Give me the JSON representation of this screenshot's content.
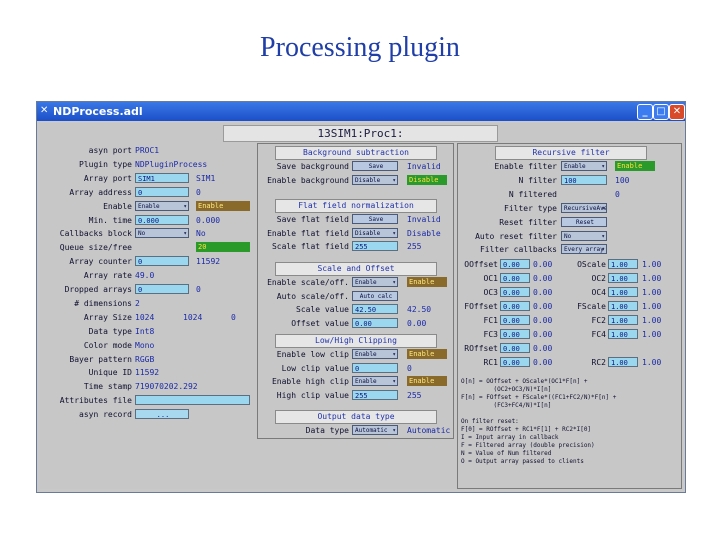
{
  "slide_title": "Processing plugin",
  "window": {
    "title": "NDProcess.adl",
    "minimize": "_",
    "maximize": "□",
    "close": "✕"
  },
  "header": "13SIM1:Proc1:",
  "colors": {
    "titlebar": "#1c4fc9",
    "input": "#9bd7ee",
    "enable_green": "#2a9a2a",
    "panel_bg": "#c7c7c7"
  },
  "left": [
    {
      "label": "asyn port",
      "value": "PROC1"
    },
    {
      "label": "Plugin type",
      "value": "NDPluginProcess"
    },
    {
      "label": "Array port",
      "input": "SIM1",
      "value": "SIM1"
    },
    {
      "label": "Array address",
      "input": "0",
      "value": "0"
    },
    {
      "label": "Enable",
      "menu": "Enable",
      "stat": "Enable",
      "stat_color": "amber"
    },
    {
      "label": "Min. time",
      "input": "0.000",
      "value": "0.000"
    },
    {
      "label": "Callbacks block",
      "menu": "No",
      "value": "No"
    },
    {
      "label": "Queue size/free",
      "value": "20",
      "stat": "20",
      "stat_color": "green"
    },
    {
      "label": "Array counter",
      "input": "0",
      "value": "11592"
    },
    {
      "label": "Array rate",
      "value": "49.0"
    },
    {
      "label": "Dropped arrays",
      "input": "0",
      "value": "0"
    },
    {
      "label": "# dimensions",
      "value": "2"
    },
    {
      "label": "Array Size",
      "values": [
        "1024",
        "1024",
        "0"
      ]
    },
    {
      "label": "Data type",
      "value": "Int8"
    },
    {
      "label": "Color mode",
      "value": "Mono"
    },
    {
      "label": "Bayer pattern",
      "value": "RGGB"
    },
    {
      "label": "Unique ID",
      "value": "11592"
    },
    {
      "label": "Time stamp",
      "value": "719070202.292"
    },
    {
      "label": "Attributes file",
      "input": ""
    },
    {
      "label": "asyn record",
      "button": "..."
    }
  ],
  "middle": {
    "background": {
      "title": "Background subtraction",
      "rows": [
        {
          "label": "Save background",
          "button": "Save",
          "value": "Invalid"
        },
        {
          "label": "Enable background",
          "menu": "Disable",
          "stat": "Disable"
        }
      ]
    },
    "flatfield": {
      "title": "Flat field normalization",
      "rows": [
        {
          "label": "Save flat field",
          "button": "Save",
          "value": "Invalid"
        },
        {
          "label": "Enable flat field",
          "menu": "Disable",
          "value": "Disable"
        },
        {
          "label": "Scale flat field",
          "input": "255",
          "value": "255"
        }
      ]
    },
    "scale": {
      "title": "Scale and Offset",
      "rows": [
        {
          "label": "Enable scale/off.",
          "menu": "Enable",
          "stat": "Enable"
        },
        {
          "label": "Auto scale/off.",
          "button": "Auto calc"
        },
        {
          "label": "Scale value",
          "input": "42.50",
          "value": "42.50"
        },
        {
          "label": "Offset value",
          "input": "0.00",
          "value": "0.00"
        }
      ]
    },
    "clip": {
      "title": "Low/High Clipping",
      "rows": [
        {
          "label": "Enable low clip",
          "menu": "Enable",
          "stat": "Enable"
        },
        {
          "label": "Low clip value",
          "input": "0",
          "value": "0"
        },
        {
          "label": "Enable high clip",
          "menu": "Enable",
          "stat": "Enable"
        },
        {
          "label": "High clip value",
          "input": "255",
          "value": "255"
        }
      ]
    },
    "output": {
      "title": "Output data type",
      "rows": [
        {
          "label": "Data type",
          "menu": "Automatic",
          "value": "Automatic"
        }
      ]
    }
  },
  "right": {
    "title": "Recursive filter",
    "top_rows": [
      {
        "label": "Enable filter",
        "menu": "Enable",
        "stat": "Enable"
      },
      {
        "label": "N filter",
        "input": "100",
        "value": "100"
      },
      {
        "label": "N filtered",
        "value": "0"
      },
      {
        "label": "Filter type",
        "menu": "RecursiveAve"
      },
      {
        "label": "Reset filter",
        "button": "Reset"
      },
      {
        "label": "Auto reset filter",
        "menu": "No"
      },
      {
        "label": "Filter callbacks",
        "menu": "Every array"
      }
    ],
    "coeffs": [
      {
        "l": "OOffset",
        "lv": "0.00",
        "r": "OScale",
        "rv": "1.00"
      },
      {
        "l": "OC1",
        "lv": "0.00",
        "r": "OC2",
        "rv": "1.00"
      },
      {
        "l": "OC3",
        "lv": "0.00",
        "r": "OC4",
        "rv": "1.00"
      },
      {
        "l": "FOffset",
        "lv": "0.00",
        "r": "FScale",
        "rv": "1.00"
      },
      {
        "l": "FC1",
        "lv": "0.00",
        "r": "FC2",
        "rv": "1.00"
      },
      {
        "l": "FC3",
        "lv": "0.00",
        "r": "FC4",
        "rv": "1.00"
      },
      {
        "l": "ROffset",
        "lv": "0.00",
        "r": "",
        "rv": ""
      },
      {
        "l": "RC1",
        "lv": "0.00",
        "r": "RC2",
        "rv": "1.00"
      }
    ],
    "notes": "O[n] = OOffset + OScale*(OC1*F[n] + \n         (OC2+OC3/N)*I[n]\nF[n] = FOffset + FScale*((FC1+FC2/N)*F[n] +\n         (FC3+FC4/N)*I[n]\n\nOn filter reset:\nF[0] = ROffset + RC1*F[1] + RC2*I[0]\nI = Input array in callback\nF = Filtered array (double precision)\nN = Value of Num filtered\nO = Output array passed to clients"
  }
}
